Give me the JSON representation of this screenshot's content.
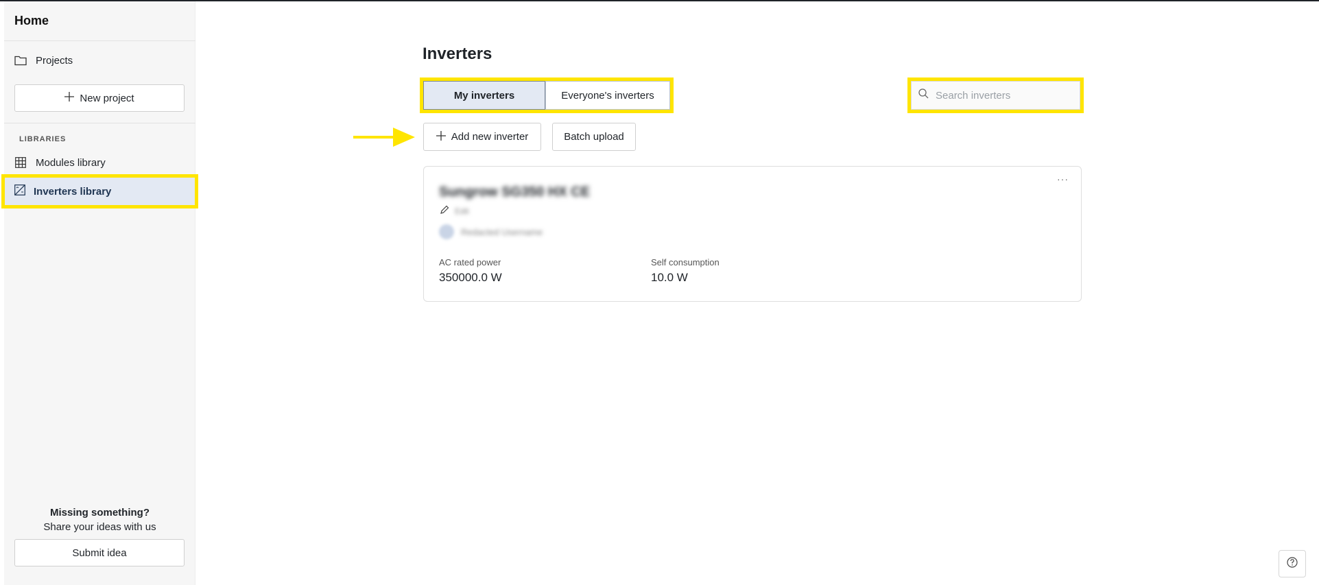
{
  "sidebar": {
    "home_label": "Home",
    "projects_label": "Projects",
    "new_project_label": "New project",
    "section_label": "LIBRARIES",
    "modules_label": "Modules library",
    "inverters_label": "Inverters library",
    "missing_title": "Missing something?",
    "missing_subtitle": "Share your ideas with us",
    "submit_label": "Submit idea"
  },
  "main": {
    "title": "Inverters",
    "tabs": [
      {
        "label": "My inverters",
        "active": true
      },
      {
        "label": "Everyone's inverters",
        "active": false
      }
    ],
    "search": {
      "placeholder": "Search inverters",
      "value": ""
    },
    "add_label": "Add new inverter",
    "batch_label": "Batch upload",
    "card": {
      "name": "Sungrow SG350 HX CE",
      "edit_text": "Edit",
      "owner": "Redacted Username",
      "specs": [
        {
          "label": "AC rated power",
          "value": "350000.0 W"
        },
        {
          "label": "Self consumption",
          "value": "10.0 W"
        }
      ]
    }
  },
  "colors": {
    "highlight": "#ffe500",
    "active_bg": "#e3e9f3"
  },
  "icons": [
    "folder-icon",
    "plus-icon",
    "grid-icon",
    "inverter-icon",
    "search-icon",
    "pencil-icon",
    "more-icon",
    "help-icon",
    "arrow-right-icon"
  ]
}
